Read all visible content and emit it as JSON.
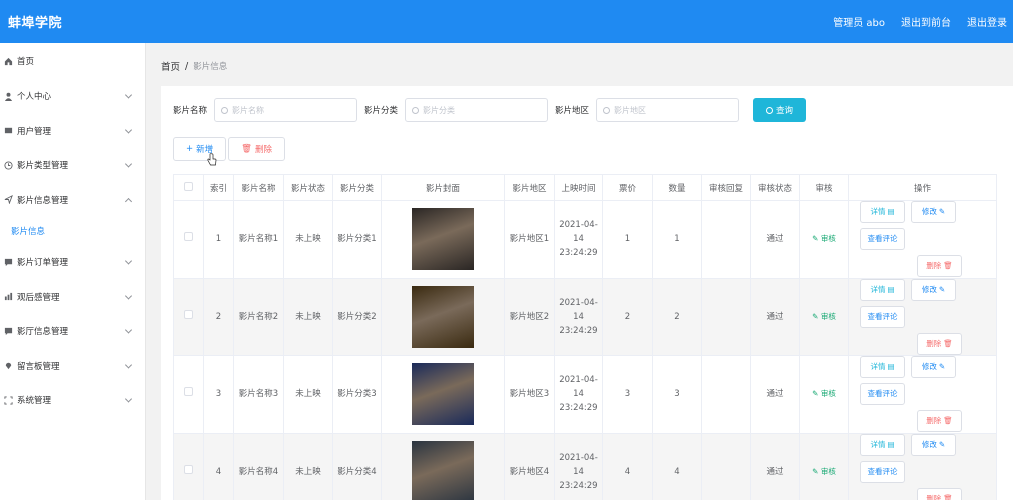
{
  "header": {
    "title": "蚌埠学院",
    "admin": "管理员 abo",
    "to_front": "退出到前台",
    "logout": "退出登录",
    "color": "#1f8af2"
  },
  "sidebar": {
    "items": [
      {
        "label": "首页",
        "icon": "home-icon"
      },
      {
        "label": "个人中心",
        "icon": "user-icon"
      },
      {
        "label": "用户管理",
        "icon": "users-icon"
      },
      {
        "label": "影片类型管理",
        "icon": "clock-icon"
      },
      {
        "label": "影片信息管理",
        "icon": "send-icon"
      },
      {
        "label": "影片信息",
        "icon": ""
      },
      {
        "label": "影片订单管理",
        "icon": "message-icon"
      },
      {
        "label": "观后感管理",
        "icon": "chart-icon"
      },
      {
        "label": "影厅信息管理",
        "icon": "message-icon"
      },
      {
        "label": "留言板管理",
        "icon": "location-icon"
      },
      {
        "label": "系统管理",
        "icon": "fullscreen-icon"
      }
    ]
  },
  "breadcrumb": {
    "home": "首页",
    "sep": "/",
    "current": "影片信息"
  },
  "search": {
    "name_label": "影片名称",
    "name_placeholder": "影片名称",
    "type_label": "影片分类",
    "type_placeholder": "影片分类",
    "area_label": "影片地区",
    "area_placeholder": "影片地区",
    "query": "查询"
  },
  "actions": {
    "add": "新增",
    "delete": "删除"
  },
  "table": {
    "headers": [
      "索引",
      "影片名称",
      "影片状态",
      "影片分类",
      "影片封面",
      "影片地区",
      "上映时间",
      "票价",
      "数量",
      "审核回复",
      "审核状态",
      "审核",
      "操作"
    ],
    "rows": [
      {
        "index": "1",
        "name": "影片名称1",
        "status": "未上映",
        "type": "影片分类1",
        "area": "影片地区1",
        "time": "2021-04-14 23:24:29",
        "price": "1",
        "qty": "1",
        "reply": "",
        "audit_status": "通过",
        "audit": "审核",
        "poster_color": "#2a2624"
      },
      {
        "index": "2",
        "name": "影片名称2",
        "status": "未上映",
        "type": "影片分类2",
        "area": "影片地区2",
        "time": "2021-04-14 23:24:29",
        "price": "2",
        "qty": "2",
        "reply": "",
        "audit_status": "通过",
        "audit": "审核",
        "poster_color": "#3a2a10"
      },
      {
        "index": "3",
        "name": "影片名称3",
        "status": "未上映",
        "type": "影片分类3",
        "area": "影片地区3",
        "time": "2021-04-14 23:24:29",
        "price": "3",
        "qty": "3",
        "reply": "",
        "audit_status": "通过",
        "audit": "审核",
        "poster_color": "#1a2a5a"
      },
      {
        "index": "4",
        "name": "影片名称4",
        "status": "未上映",
        "type": "影片分类4",
        "area": "影片地区4",
        "time": "2021-04-14 23:24:29",
        "price": "4",
        "qty": "4",
        "reply": "",
        "audit_status": "通过",
        "audit": "审核",
        "poster_color": "#2a3440"
      }
    ],
    "ops": {
      "detail": "详情",
      "edit": "修改",
      "review": "查看评论",
      "remove": "删除"
    }
  }
}
